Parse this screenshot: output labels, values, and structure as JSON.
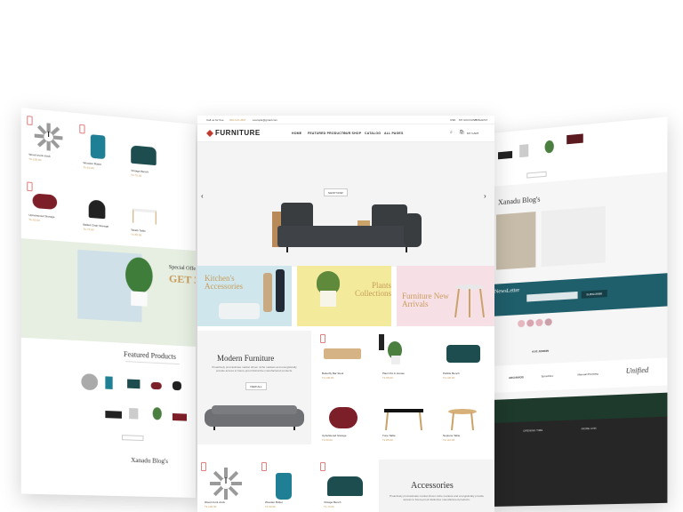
{
  "header": {
    "call_text": "Call us for free",
    "phone": "000-123-4567",
    "email": "example@gmail.com",
    "currency": "USD",
    "account": "MY ACCOUNT",
    "wishlist": "WISHLIST",
    "logo": "FURNITURE",
    "nav": [
      "HOME",
      "FEATURED PRODUCTS",
      "OUR SHOP",
      "CATALOG",
      "ALL PAGES"
    ],
    "cart": "MY CART"
  },
  "hero": {
    "button": "SHOP NOW"
  },
  "banners": [
    {
      "title": "Kitchen's Accessories",
      "color": "#cfe7ec"
    },
    {
      "title": "Plants Collections",
      "color": "#f3ea9b"
    },
    {
      "title": "Furniture New Arrivals",
      "color": "#f7dfe6"
    }
  ],
  "modern": {
    "title": "Modern Furniture",
    "desc": "Proactively procrastinate market driven niche markets and energistically provide access to future-proof distinctive manufactured products.",
    "button": "VIEW ALL"
  },
  "products_center": [
    {
      "name": "Butterfly Bar Stool",
      "price": "Tk 100.00"
    },
    {
      "name": "Plant Pot in House",
      "price": "Tk 95.00"
    },
    {
      "name": "Pebble Bench",
      "price": "Tk 120.00"
    },
    {
      "name": "Upholstered Storage",
      "price": "Tk 90.00"
    },
    {
      "name": "Tune Table",
      "price": "Tk 85.00"
    },
    {
      "name": "Neptune Table",
      "price": "Tk 110.00"
    },
    {
      "name": "Wood trunk clock",
      "price": "Tk 100.00"
    },
    {
      "name": "Wooden Butter",
      "price": "Tk 60.00"
    },
    {
      "name": "Vintage Bench",
      "price": "Tk 70.00"
    }
  ],
  "accessories": {
    "title": "Accessories",
    "desc": "Proactively procrastinate market driven niche markets and energistically provide access to future-proof distinctive manufactured products."
  },
  "left_panel": {
    "featured_title": "Featured Products",
    "special_offer": "Special Offer",
    "offer_get": "GET 30",
    "blog_title": "Xanadu Blog's",
    "products": [
      {
        "name": "Wood trunk clock",
        "price": "Tk 100.00"
      },
      {
        "name": "Wooden Butter",
        "price": "Tk 60.00"
      },
      {
        "name": "Vintage Bench",
        "price": "Tk 70.00"
      },
      {
        "name": "Upholstered Storage",
        "price": "Tk 90.00"
      },
      {
        "name": "Balled Chair Storage",
        "price": "Tk 75.00"
      },
      {
        "name": "Tarath Table",
        "price": "Tk 80.00"
      }
    ]
  },
  "right_panel": {
    "blog_title": "Xanadu Blog's",
    "newsletter": "NewsLetter",
    "subscribe": "SUBSCRIBE",
    "author": "KYE JORDIN",
    "footer_col1": "OPENING TIME",
    "footer_col2": "MORE LINK",
    "brands": [
      "ARCHIVIOS",
      "SpinoFlex",
      "Manual Pressing",
      "Unified"
    ]
  },
  "colors": {
    "accent": "#c0392b",
    "price": "#c89c5c",
    "newsletter_bg": "#1f5e6b",
    "footer_bg": "#262626"
  }
}
